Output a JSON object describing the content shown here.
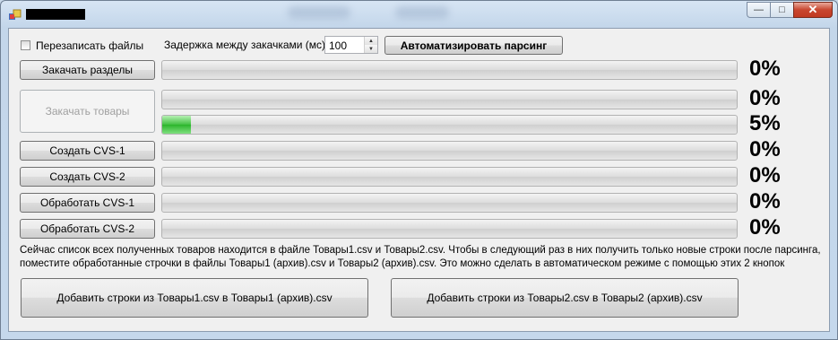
{
  "window": {
    "title": ""
  },
  "options": {
    "overwrite_label": "Перезаписать файлы",
    "delay_label": "Задержка между закачками (мс):",
    "delay_value": "100",
    "automate_label": "Автоматизировать парсинг"
  },
  "rows": [
    {
      "button": "Закачать разделы",
      "progress": 0,
      "percent": "0%"
    },
    {
      "button": "Закачать товары",
      "progress": 0,
      "percent": "0%"
    },
    {
      "button": "",
      "progress": 0.05,
      "percent": "5%"
    },
    {
      "button": "Создать CVS-1",
      "progress": 0,
      "percent": "0%"
    },
    {
      "button": "Создать CVS-2",
      "progress": 0,
      "percent": "0%"
    },
    {
      "button": "Обработать CVS-1",
      "progress": 0,
      "percent": "0%"
    },
    {
      "button": "Обработать CVS-2",
      "progress": 0,
      "percent": "0%"
    }
  ],
  "info": {
    "line1": "Сейчас список всех полученных товаров находится в файле Товары1.csv и Товары2.csv. Чтобы в следующий раз в них получить только новые строки после парсинга,",
    "line2": "поместите обработанные строчки в файлы Товары1 (архив).csv и Товары2 (архив).csv. Это можно сделать в автоматическом режиме с помощью этих 2 кнопок"
  },
  "actions": {
    "add1": "Добавить строки из Товары1.csv в Товары1 (архив).csv",
    "add2": "Добавить строки из Товары2.csv в Товары2 (архив).csv"
  },
  "colors": {
    "progress_fill": "#40c040",
    "close_button": "#c8462f"
  }
}
